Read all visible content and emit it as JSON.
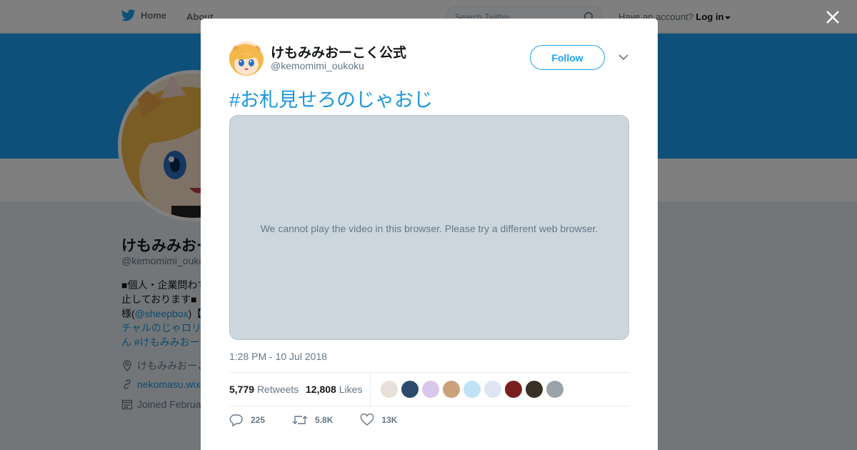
{
  "topbar": {
    "home_label": "Home",
    "about_label": "About",
    "search_placeholder": "Search Twitter",
    "account_prompt": "Have an account?",
    "login_label": "Log in"
  },
  "profile": {
    "name": "けもみみおーこく公式",
    "handle": "@kemomimi_oukoku",
    "bio_lines": [
      "■個人・企業問わず",
      "止しております■",
      "様(",
      "@sheepbox",
      ")【",
      "チャルのじゃロリ",
      "ん #けもみみおー"
    ],
    "location": "けもみみおーこ",
    "url": "nekomasu.wix",
    "joined": "Joined Februa"
  },
  "tweet": {
    "author_name": "けもみみおーこく公式",
    "author_handle": "@kemomimi_oukoku",
    "follow_label": "Follow",
    "text": "#お札見せろのじゃおじ",
    "video_message": "We cannot play the video in this browser. Please try a different web browser.",
    "timestamp": "1:28 PM - 10 Jul 2018",
    "retweets_count": "5,779",
    "retweets_label": "Retweets",
    "likes_count": "12,808",
    "likes_label": "Likes",
    "reply_count": "225",
    "retweet_count_short": "5.8K",
    "like_count_short": "13K"
  },
  "likers": [
    {
      "icon": "liker-avatar",
      "color": "#e8e0d8"
    },
    {
      "icon": "liker-avatar",
      "color": "#2c4a6b"
    },
    {
      "icon": "liker-avatar",
      "color": "#d9c6ec"
    },
    {
      "icon": "liker-avatar",
      "color": "#c9a27a"
    },
    {
      "icon": "liker-avatar",
      "color": "#bfe3f5"
    },
    {
      "icon": "liker-avatar",
      "color": "#dfe6f3"
    },
    {
      "icon": "liker-avatar",
      "color": "#7a1f1f"
    },
    {
      "icon": "liker-avatar",
      "color": "#3b3026"
    },
    {
      "icon": "liker-avatar",
      "color": "#9aa3a8"
    }
  ],
  "colors": {
    "accent": "#1da1f2",
    "link": "#1b95e0",
    "text_secondary": "#657786",
    "video_bg": "#ccd6dd"
  }
}
